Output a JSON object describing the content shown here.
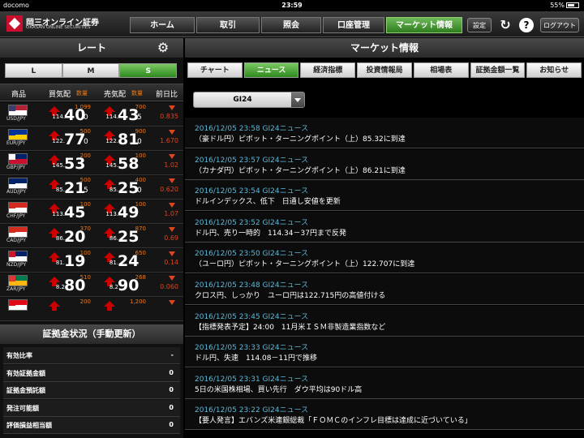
{
  "status": {
    "carrier": "docomo",
    "time": "23:59",
    "battery": "55%"
  },
  "header": {
    "brand": "岡三オンライン証券",
    "brand_en": "OKASAN ONLINE SECURITIES",
    "tabs": [
      "ホーム",
      "取引",
      "照会",
      "口座管理",
      "マーケット情報"
    ],
    "settings": "設定",
    "logout": "ログアウト"
  },
  "left": {
    "title": "レート",
    "lms": [
      "L",
      "M",
      "S"
    ],
    "cols": {
      "product": "商品",
      "bid": "買気配",
      "bid_tag": "数量",
      "ask": "売気配",
      "ask_tag": "数量",
      "chg": "前日比"
    },
    "rows": [
      {
        "pair": "USD/JPY",
        "bq": "1,099",
        "bp": "114.",
        "bb": "40",
        "bs": "0",
        "aq": "700",
        "ap": "114.",
        "ab": "43",
        "as": "5",
        "c": "0.835"
      },
      {
        "pair": "EUR/JPY",
        "bq": "500",
        "bp": "122.",
        "bb": "77",
        "bs": "0",
        "aq": "900",
        "ap": "122.",
        "ab": "81",
        "as": "0",
        "c": "1.670"
      },
      {
        "pair": "GBP/JPY",
        "bq": "200",
        "bp": "145.",
        "bb": "53",
        "bs": "",
        "aq": "100",
        "ap": "145.",
        "ab": "58",
        "as": "",
        "c": "1.02"
      },
      {
        "pair": "AUD/JPY",
        "bq": "500",
        "bp": "85.",
        "bb": "21",
        "bs": "5",
        "aq": "400",
        "ap": "85.",
        "ab": "25",
        "as": "0",
        "c": "0.620"
      },
      {
        "pair": "CHF/JPY",
        "bq": "100",
        "bp": "113.",
        "bb": "45",
        "bs": "",
        "aq": "100",
        "ap": "113.",
        "ab": "49",
        "as": "",
        "c": "1.07"
      },
      {
        "pair": "CAD/JPY",
        "bq": "370",
        "bp": "86.",
        "bb": "20",
        "bs": "",
        "aq": "870",
        "ap": "86.",
        "ab": "25",
        "as": "",
        "c": "0.69"
      },
      {
        "pair": "NZD/JPY",
        "bq": "100",
        "bp": "81.",
        "bb": "19",
        "bs": "",
        "aq": "650",
        "ap": "81.",
        "ab": "24",
        "as": "",
        "c": "0.14"
      },
      {
        "pair": "ZAR/JPY",
        "bq": "510",
        "bp": "8.2",
        "bb": "80",
        "bs": "",
        "aq": "268",
        "ap": "8.2",
        "ab": "90",
        "as": "",
        "c": "0.060"
      },
      {
        "pair": "",
        "bq": "200",
        "bp": "",
        "bb": "",
        "bs": "",
        "aq": "1,200",
        "ap": "",
        "ab": "",
        "as": "",
        "c": ""
      }
    ],
    "margin_title": "証拠金状況（手動更新）",
    "margin": [
      {
        "k": "有効比率",
        "v": "-"
      },
      {
        "k": "有効証拠金額",
        "v": "0"
      },
      {
        "k": "証拠金預託額",
        "v": "0"
      },
      {
        "k": "発注可能額",
        "v": "0"
      },
      {
        "k": "評価損益相当額",
        "v": "0"
      }
    ]
  },
  "right": {
    "title": "マーケット情報",
    "tabs": [
      "チャート",
      "ニュース",
      "経済指標",
      "投資情報局",
      "相場表",
      "証拠金額一覧",
      "お知らせ"
    ],
    "selector": "GI24",
    "news": [
      {
        "d": "2016/12/05 23:58 GI24ニュース",
        "t": "（豪ドル円）ピボット・ターニングポイント（上）85.32に到達"
      },
      {
        "d": "2016/12/05 23:57 GI24ニュース",
        "t": "（カナダ円）ピボット・ターニングポイント（上）86.21に到達"
      },
      {
        "d": "2016/12/05 23:54 GI24ニュース",
        "t": "ドルインデックス、低下　日通し安値を更新"
      },
      {
        "d": "2016/12/05 23:52 GI24ニュース",
        "t": "ドル円、売り一時的　114.34－37円まで反発"
      },
      {
        "d": "2016/12/05 23:50 GI24ニュース",
        "t": "（ユーロ円）ピボット・ターニングポイント（上）122.707に到達"
      },
      {
        "d": "2016/12/05 23:48 GI24ニュース",
        "t": "クロス円、しっかり　ユーロ円は122.715円の高値付ける"
      },
      {
        "d": "2016/12/05 23:45 GI24ニュース",
        "t": "【指標発表予定】24:00　11月米ＩＳＭ非製造業指数など"
      },
      {
        "d": "2016/12/05 23:33 GI24ニュース",
        "t": "ドル円、失速　114.08－11円で推移"
      },
      {
        "d": "2016/12/05 23:31 GI24ニュース",
        "t": "5日の米国株相場、買い先行　ダウ平均は90ドル高"
      },
      {
        "d": "2016/12/05 23:22 GI24ニュース",
        "t": "【要人発言】エバンズ米連銀総裁「ＦＯＭＣのインフレ目標は達成に近づいている」"
      }
    ]
  }
}
